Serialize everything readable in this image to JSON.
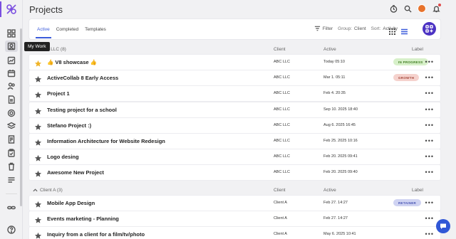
{
  "page": {
    "title": "Projects",
    "tooltip": "My Work"
  },
  "colors": {
    "accent": "#3b5bdb",
    "brand": "#4b32c3",
    "in_progress_bg": "#d7f0c9",
    "in_progress_fg": "#3d7a1e",
    "growth_bg": "#f5d2cd",
    "growth_fg": "#a4473a",
    "retainer_bg": "#cfd3f2",
    "retainer_fg": "#4855b3"
  },
  "tabs": [
    {
      "label": "Active",
      "active": true
    },
    {
      "label": "Completed",
      "active": false
    },
    {
      "label": "Templates",
      "active": false
    }
  ],
  "toolbar": {
    "filter": "Filter",
    "group_prefix": "Group:",
    "group_value": "Client",
    "sort_prefix": "Sort:",
    "sort_value": "Activity"
  },
  "columns": {
    "client": "Client",
    "active": "Active",
    "label": "Label"
  },
  "groups": [
    {
      "name": "ABC LLC (8)",
      "rows": [
        {
          "name": "👍 V8 showcase 👍",
          "client": "ABC LLC",
          "date": "Today 05:10",
          "label": "IN PROGRESS",
          "starred": true
        },
        {
          "name": "ActiveCollab 8 Early Access",
          "client": "ABC LLC",
          "date": "Mar 1. 05:11",
          "label": "GROWTH",
          "starred": false
        },
        {
          "name": "Project 1",
          "client": "ABC LLC",
          "date": "Feb 4. 20:35",
          "label": "",
          "starred": false
        },
        {
          "name": "Testing project for a school",
          "client": "ABC LLC",
          "date": "Sep 10. 2025 18:40",
          "label": "",
          "starred": false
        },
        {
          "name": "Stefano Project :)",
          "client": "ABC LLC",
          "date": "Aug 6. 2025 16:45",
          "label": "",
          "starred": false
        },
        {
          "name": "Information Architecture for Website Redesign",
          "client": "ABC LLC",
          "date": "Feb 25. 2025 10:16",
          "label": "",
          "starred": false
        },
        {
          "name": "Logo desing",
          "client": "ABC LLC",
          "date": "Feb 20. 2025 09:41",
          "label": "",
          "starred": false
        },
        {
          "name": "Awesome New Project",
          "client": "ABC LLC",
          "date": "Feb 20. 2025 09:40",
          "label": "",
          "starred": false
        }
      ]
    },
    {
      "name": "Client A (3)",
      "rows": [
        {
          "name": "Mobile App Design",
          "client": "Client A",
          "date": "Feb 27. 14:27",
          "label": "RETAINER",
          "starred": false
        },
        {
          "name": "Events marketing - Planning",
          "client": "Client A",
          "date": "Feb 27. 14:27",
          "label": "",
          "starred": false
        },
        {
          "name": "Inquiry from a client for a film/tv/photo",
          "client": "Client A",
          "date": "May 6. 2025 10:41",
          "label": "",
          "starred": false
        }
      ]
    }
  ]
}
